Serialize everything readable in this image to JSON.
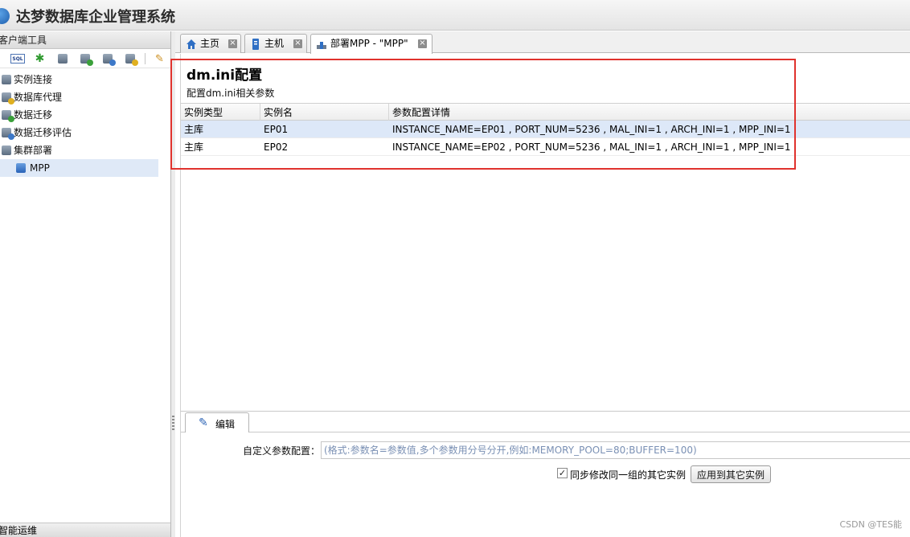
{
  "app": {
    "title": "达梦数据库企业管理系统"
  },
  "left_panel": {
    "header": "客户端工具",
    "toolbar": {
      "sql_label": "SQL"
    },
    "tree": [
      {
        "label": "实例连接"
      },
      {
        "label": "数据库代理"
      },
      {
        "label": "数据迁移"
      },
      {
        "label": "数据迁移评估"
      },
      {
        "label": "集群部署"
      },
      {
        "label": "MPP"
      }
    ],
    "bottom_section": "智能运维"
  },
  "tabs": [
    {
      "label": "主页",
      "icon": "home-icon",
      "close": "×"
    },
    {
      "label": "主机",
      "icon": "server-icon",
      "close": "×"
    },
    {
      "label": "部署MPP - \"MPP\"",
      "icon": "cluster-icon",
      "close": "×"
    }
  ],
  "config": {
    "title": "dm.ini配置",
    "subtitle": "配置dm.ini相关参数",
    "columns": [
      "实例类型",
      "实例名",
      "参数配置详情"
    ],
    "rows": [
      {
        "type": "主库",
        "name": "EP01",
        "detail": "INSTANCE_NAME=EP01 , PORT_NUM=5236 , MAL_INI=1 , ARCH_INI=1 , MPP_INI=1"
      },
      {
        "type": "主库",
        "name": "EP02",
        "detail": "INSTANCE_NAME=EP02 , PORT_NUM=5236 , MAL_INI=1 , ARCH_INI=1 , MPP_INI=1"
      }
    ]
  },
  "edit": {
    "tab_label": "编辑",
    "param_label": "自定义参数配置：",
    "param_placeholder": "(格式:参数名=参数值,多个参数用分号分开,例如:MEMORY_POOL=80;BUFFER=100)",
    "param_value": "",
    "sync_checked": true,
    "sync_check_mark": "✓",
    "sync_label": "同步修改同一组的其它实例",
    "apply_button": "应用到其它实例"
  },
  "watermark": "CSDN @TES能",
  "colors": {
    "highlight_box": "#e0322d",
    "selected_row": "#dde8f8"
  }
}
